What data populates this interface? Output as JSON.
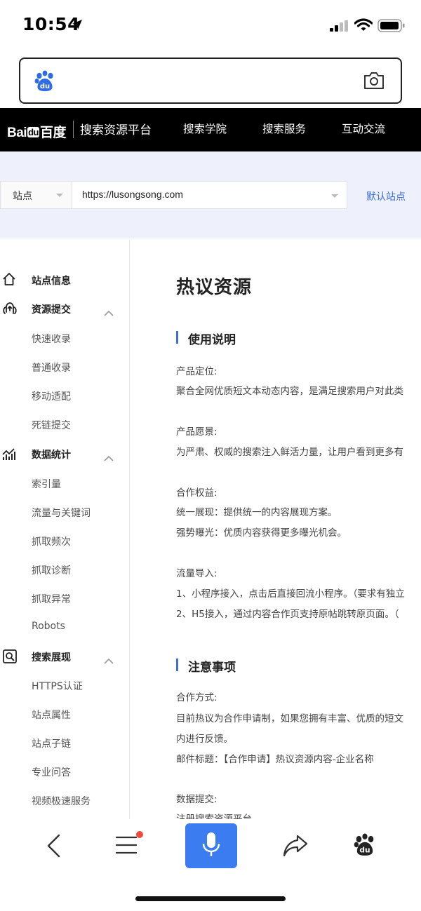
{
  "status_bar": {
    "time": "10:54"
  },
  "search_box": {
    "placeholder": ""
  },
  "header": {
    "logo_bai": "Bai",
    "logo_du": "du",
    "logo_baidu": "百度",
    "platform": "搜索资源平台",
    "nav": [
      "搜索学院",
      "搜索服务",
      "互动交流"
    ]
  },
  "site_selector": {
    "type_label": "站点",
    "url": "https://lusongsong.com",
    "default_site": "默认站点"
  },
  "sidebar": {
    "site_info": "站点信息",
    "resource_submit": {
      "label": "资源提交",
      "items": [
        "快速收录",
        "普通收录",
        "移动适配",
        "死链提交"
      ]
    },
    "data_stats": {
      "label": "数据统计",
      "items": [
        "索引量",
        "流量与关键词",
        "抓取频次",
        "抓取诊断",
        "抓取异常",
        "Robots"
      ]
    },
    "search_display": {
      "label": "搜索展现",
      "items": [
        "HTTPS认证",
        "站点属性",
        "站点子链",
        "专业问答",
        "视频极速服务"
      ]
    }
  },
  "main": {
    "title": "热议资源",
    "usage": {
      "heading": "使用说明",
      "positioning_label": "产品定位:",
      "positioning_text": "聚合全网优质短文本动态内容，是满足搜索用户对此类",
      "vision_label": "产品愿景:",
      "vision_text": "为严肃、权威的搜索注入鲜活力量，让用户看到更多有",
      "benefits_label": "合作权益:",
      "benefit1": "统一展现：提供统一的内容展现方案。",
      "benefit2": "强势曝光：优质内容获得更多曝光机会。",
      "traffic_label": "流量导入:",
      "traffic1": "1、小程序接入，点击后直接回流小程序。（要求有独立",
      "traffic2": "2、H5接入，通过内容合作页支持原帖跳转原页面。（"
    },
    "notes": {
      "heading": "注意事项",
      "method_label": "合作方式:",
      "method_text": "目前热议为合作申请制，如果您拥有丰富、优质的短文",
      "method_text2": "内进行反馈。",
      "email_title": "邮件标题：【合作申请】热议资源内容-企业名称",
      "data_submit_label": "数据提交:",
      "data_submit_text": "注册搜索资源平台"
    }
  },
  "colors": {
    "accent": "#3a6fd8",
    "mic": "#3b7cf0",
    "header_bg": "#000000",
    "band_bg": "#eef0fb"
  }
}
